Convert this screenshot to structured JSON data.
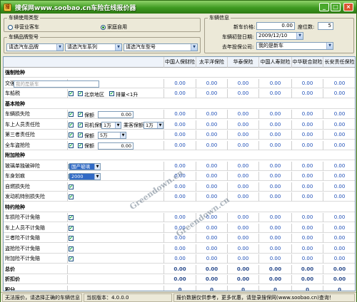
{
  "window": {
    "title": "搜保网www.soobao.cn车险在线报价器",
    "icon": "app-logo-icon"
  },
  "usage": {
    "legend": "车辆使用类型",
    "options": [
      {
        "label": "非营业客车",
        "selected": false
      },
      {
        "label": "家庭自用",
        "selected": true
      }
    ]
  },
  "brand": {
    "legend": "车辆品牌型号",
    "brand_select": "请选汽车品牌",
    "series_select": "请选汽车系列",
    "model_select": "请选汽车型号"
  },
  "vehicle": {
    "legend": "车辆信息",
    "price_label": "新车价格:",
    "price_value": "0.00",
    "seats_label": "座位数:",
    "seats_value": "5",
    "reg_date_label": "车辆初登日期:",
    "reg_date_value": "2009/12/10",
    "last_insurer_label": "去年投保公司:",
    "last_insurer_value": "我的是新车"
  },
  "companies": [
    "中国人保财险",
    "太平洋保险",
    "华泰保险",
    "中国人寿财险",
    "中华联合财险",
    "长安责任保险"
  ],
  "rows": {
    "s_mandatory": "强制险种",
    "r_jq": {
      "name": "交强险",
      "option": "我的是新车",
      "values": [
        "0.00",
        "0.00",
        "0.00",
        "0.00",
        "0.00",
        "0.00"
      ]
    },
    "r_ccs": {
      "name": "车船税",
      "cb1": "北京地区",
      "cb2": "排量<1升",
      "values": [
        "0.00",
        "0.00",
        "0.00",
        "0.00",
        "0.00",
        "0.00"
      ]
    },
    "s_basic": "基本险种",
    "r_loss": {
      "name": "车辆损失险",
      "cb": "保额",
      "amount": "0.00",
      "values": [
        "0.00",
        "0.00",
        "0.00",
        "0.00",
        "0.00",
        "0.00"
      ]
    },
    "r_seat": {
      "name": "车上人员责任险",
      "cb": "司机保额",
      "driver": "1万",
      "passenger_label": "乘客保额",
      "passenger": "1万",
      "values": [
        "0.00",
        "0.00",
        "0.00",
        "0.00",
        "0.00",
        "0.00"
      ]
    },
    "r_third": {
      "name": "第三者责任险",
      "cb": "保额",
      "amount": "5万",
      "values": [
        "0.00",
        "0.00",
        "0.00",
        "0.00",
        "0.00",
        "0.00"
      ]
    },
    "r_theft": {
      "name": "全车盗抢险",
      "cb": "保额",
      "amount": "0.00",
      "values": [
        "0.00",
        "0.00",
        "0.00",
        "0.00",
        "0.00",
        "0.00"
      ]
    },
    "s_extra": "附加险种",
    "r_glass": {
      "name": "玻璃单独破碎险",
      "option": "国产玻璃",
      "values": [
        "0.00",
        "0.00",
        "0.00",
        "0.00",
        "0.00",
        "0.00"
      ]
    },
    "r_scratch": {
      "name": "车身划痕",
      "option": "2000",
      "values": [
        "0.00",
        "0.00",
        "0.00",
        "0.00",
        "0.00",
        "0.00"
      ]
    },
    "r_fire": {
      "name": "自燃损失险",
      "values": [
        "0.00",
        "0.00",
        "0.00",
        "0.00",
        "0.00",
        "0.00"
      ]
    },
    "r_engine": {
      "name": "发动机特别损失险",
      "values": [
        "0.00",
        "0.00",
        "0.00",
        "0.00",
        "0.00",
        "0.00"
      ]
    },
    "s_special": "特约险种",
    "r_d1": {
      "name": "车损险不计免赔",
      "values": [
        "0.00",
        "0.00",
        "0.00",
        "0.00",
        "0.00",
        "0.00"
      ]
    },
    "r_d2": {
      "name": "车上人员不计免赔",
      "values": [
        "0.00",
        "0.00",
        "0.00",
        "0.00",
        "0.00",
        "0.00"
      ]
    },
    "r_d3": {
      "name": "三者险不计免赔",
      "values": [
        "0.00",
        "0.00",
        "0.00",
        "0.00",
        "0.00",
        "0.00"
      ]
    },
    "r_d4": {
      "name": "盗抢险不计免赔",
      "values": [
        "0.00",
        "0.00",
        "0.00",
        "0.00",
        "0.00",
        "0.00"
      ]
    },
    "r_d5": {
      "name": "附加险不计免赔",
      "values": [
        "0.00",
        "0.00",
        "0.00",
        "0.00",
        "0.00",
        "0.00"
      ]
    },
    "r_total": {
      "name": "总价",
      "values": [
        "0.00",
        "0.00",
        "0.00",
        "0.00",
        "0.00",
        "0.00"
      ]
    },
    "r_discount": {
      "name": "折扣价",
      "values": [
        "0.00",
        "0.00",
        "0.00",
        "0.00",
        "0.00",
        "0.00"
      ]
    },
    "r_points": {
      "name": "积分",
      "values": [
        "0",
        "0",
        "0",
        "0",
        "0",
        "0"
      ]
    }
  },
  "watermark": "Greendown.cn",
  "status": {
    "left": "无法报价，请选择正确的车辆信息",
    "version": "当前版本：4.0.0.0",
    "right": "报价数据仅供参考，更多优惠，请登录搜保网(www.soobao.cn)查询！"
  }
}
